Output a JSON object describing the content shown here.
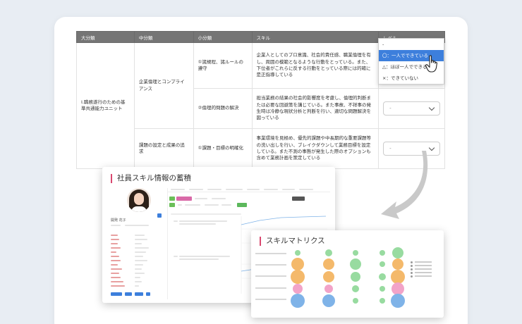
{
  "table": {
    "headers": [
      "大分類",
      "中分類",
      "小分類",
      "スキル",
      "レベル"
    ],
    "major": "Ⅰ.職務遂行のための基準共通能力ユニット",
    "rows": [
      {
        "mid": "企業倫理とコンプライアンス",
        "sub": "①諸規程、諸ルールの遵守",
        "skill": "企業人としてのプロ意識、社会的責任感、職業倫理を有し、周囲の模範となるような行動をとっている。また、下位者がこれらに反する行動をとっている際には的確に是正指導している",
        "level": "-"
      },
      {
        "mid": "",
        "sub": "②倫理的問題の解決",
        "skill": "担当業務の結果の社会的影響度を考慮し、倫理的判断または必要な回避策を講じている。また事故、不祥事の発生時は冷静な現状分析と判断を行い、適切な問題解決を図っている",
        "level": "-"
      },
      {
        "mid": "課題の設定と成果の追求",
        "sub": "①課題・目標の明確化",
        "skill": "事業環境を見極め、優先的課題や中長期的な重要課題等の洗い出しを行い、ブレイクダウンして業務目標を設定している。また不測の事態が発生した際のオプションも含めて業務計画を策定している",
        "level": "-"
      }
    ]
  },
  "dropdown": {
    "options": [
      "-",
      "〇：一人でできている",
      "△：ほぼ一人でできる",
      "×：できていない"
    ],
    "selected_index": 1
  },
  "panel_profile": {
    "title": "社員スキル情報の蓄積",
    "name": "開発 花子"
  },
  "panel_matrix": {
    "title": "スキルマトリクス"
  },
  "colors": {
    "accent_pink": "#d9486f",
    "header_gray": "#757575",
    "select_blue": "#3d7fdc",
    "bubble_blue": "#7fb3e8",
    "bubble_green": "#98dba0",
    "bubble_orange": "#f4b96b",
    "bubble_pink": "#f2a3c8"
  },
  "icons": {
    "cursor": "pointing-hand-icon",
    "dropdown": "chevron-down-icon",
    "arrow": "curved-arrow-icon"
  }
}
